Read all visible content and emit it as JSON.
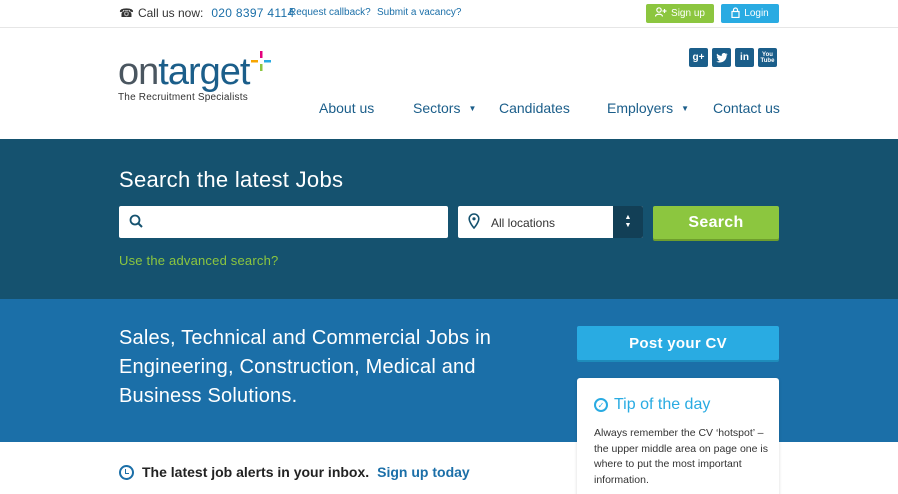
{
  "topbar": {
    "call_label": "Call us now:",
    "phone": "020 8397 4114",
    "callback_link": "Request callback?",
    "vacancy_link": "Submit a vacancy?",
    "signup_label": "Sign up",
    "login_label": "Login"
  },
  "logo": {
    "word_on": "on",
    "word_target": "target",
    "tagline": "The Recruitment Specialists"
  },
  "social": [
    "g+",
    "t",
    "in",
    "You Tube"
  ],
  "nav": {
    "about": "About us",
    "sectors": "Sectors",
    "candidates": "Candidates",
    "employers": "Employers",
    "contact": "Contact us"
  },
  "search": {
    "heading": "Search the latest Jobs",
    "keyword_placeholder": "",
    "location_value": "All locations",
    "button_label": "Search",
    "advanced_link": "Use the advanced search?"
  },
  "hero": {
    "tagline": "Sales, Technical and Commercial Jobs in Engineering, Construction, Medical and Business Solutions.",
    "post_cv_label": "Post your CV"
  },
  "tip": {
    "heading": "Tip of the day",
    "body": "Always remember the CV ‘hotspot’ – the upper middle area on page one is where to put the most important information."
  },
  "alerts": {
    "text": "The latest job alerts in your inbox.",
    "link": "Sign up today"
  },
  "colors": {
    "brand_dark": "#15526f",
    "brand_blue": "#1b6fa8",
    "accent_green": "#8cc63f",
    "accent_cyan": "#29abe2"
  }
}
